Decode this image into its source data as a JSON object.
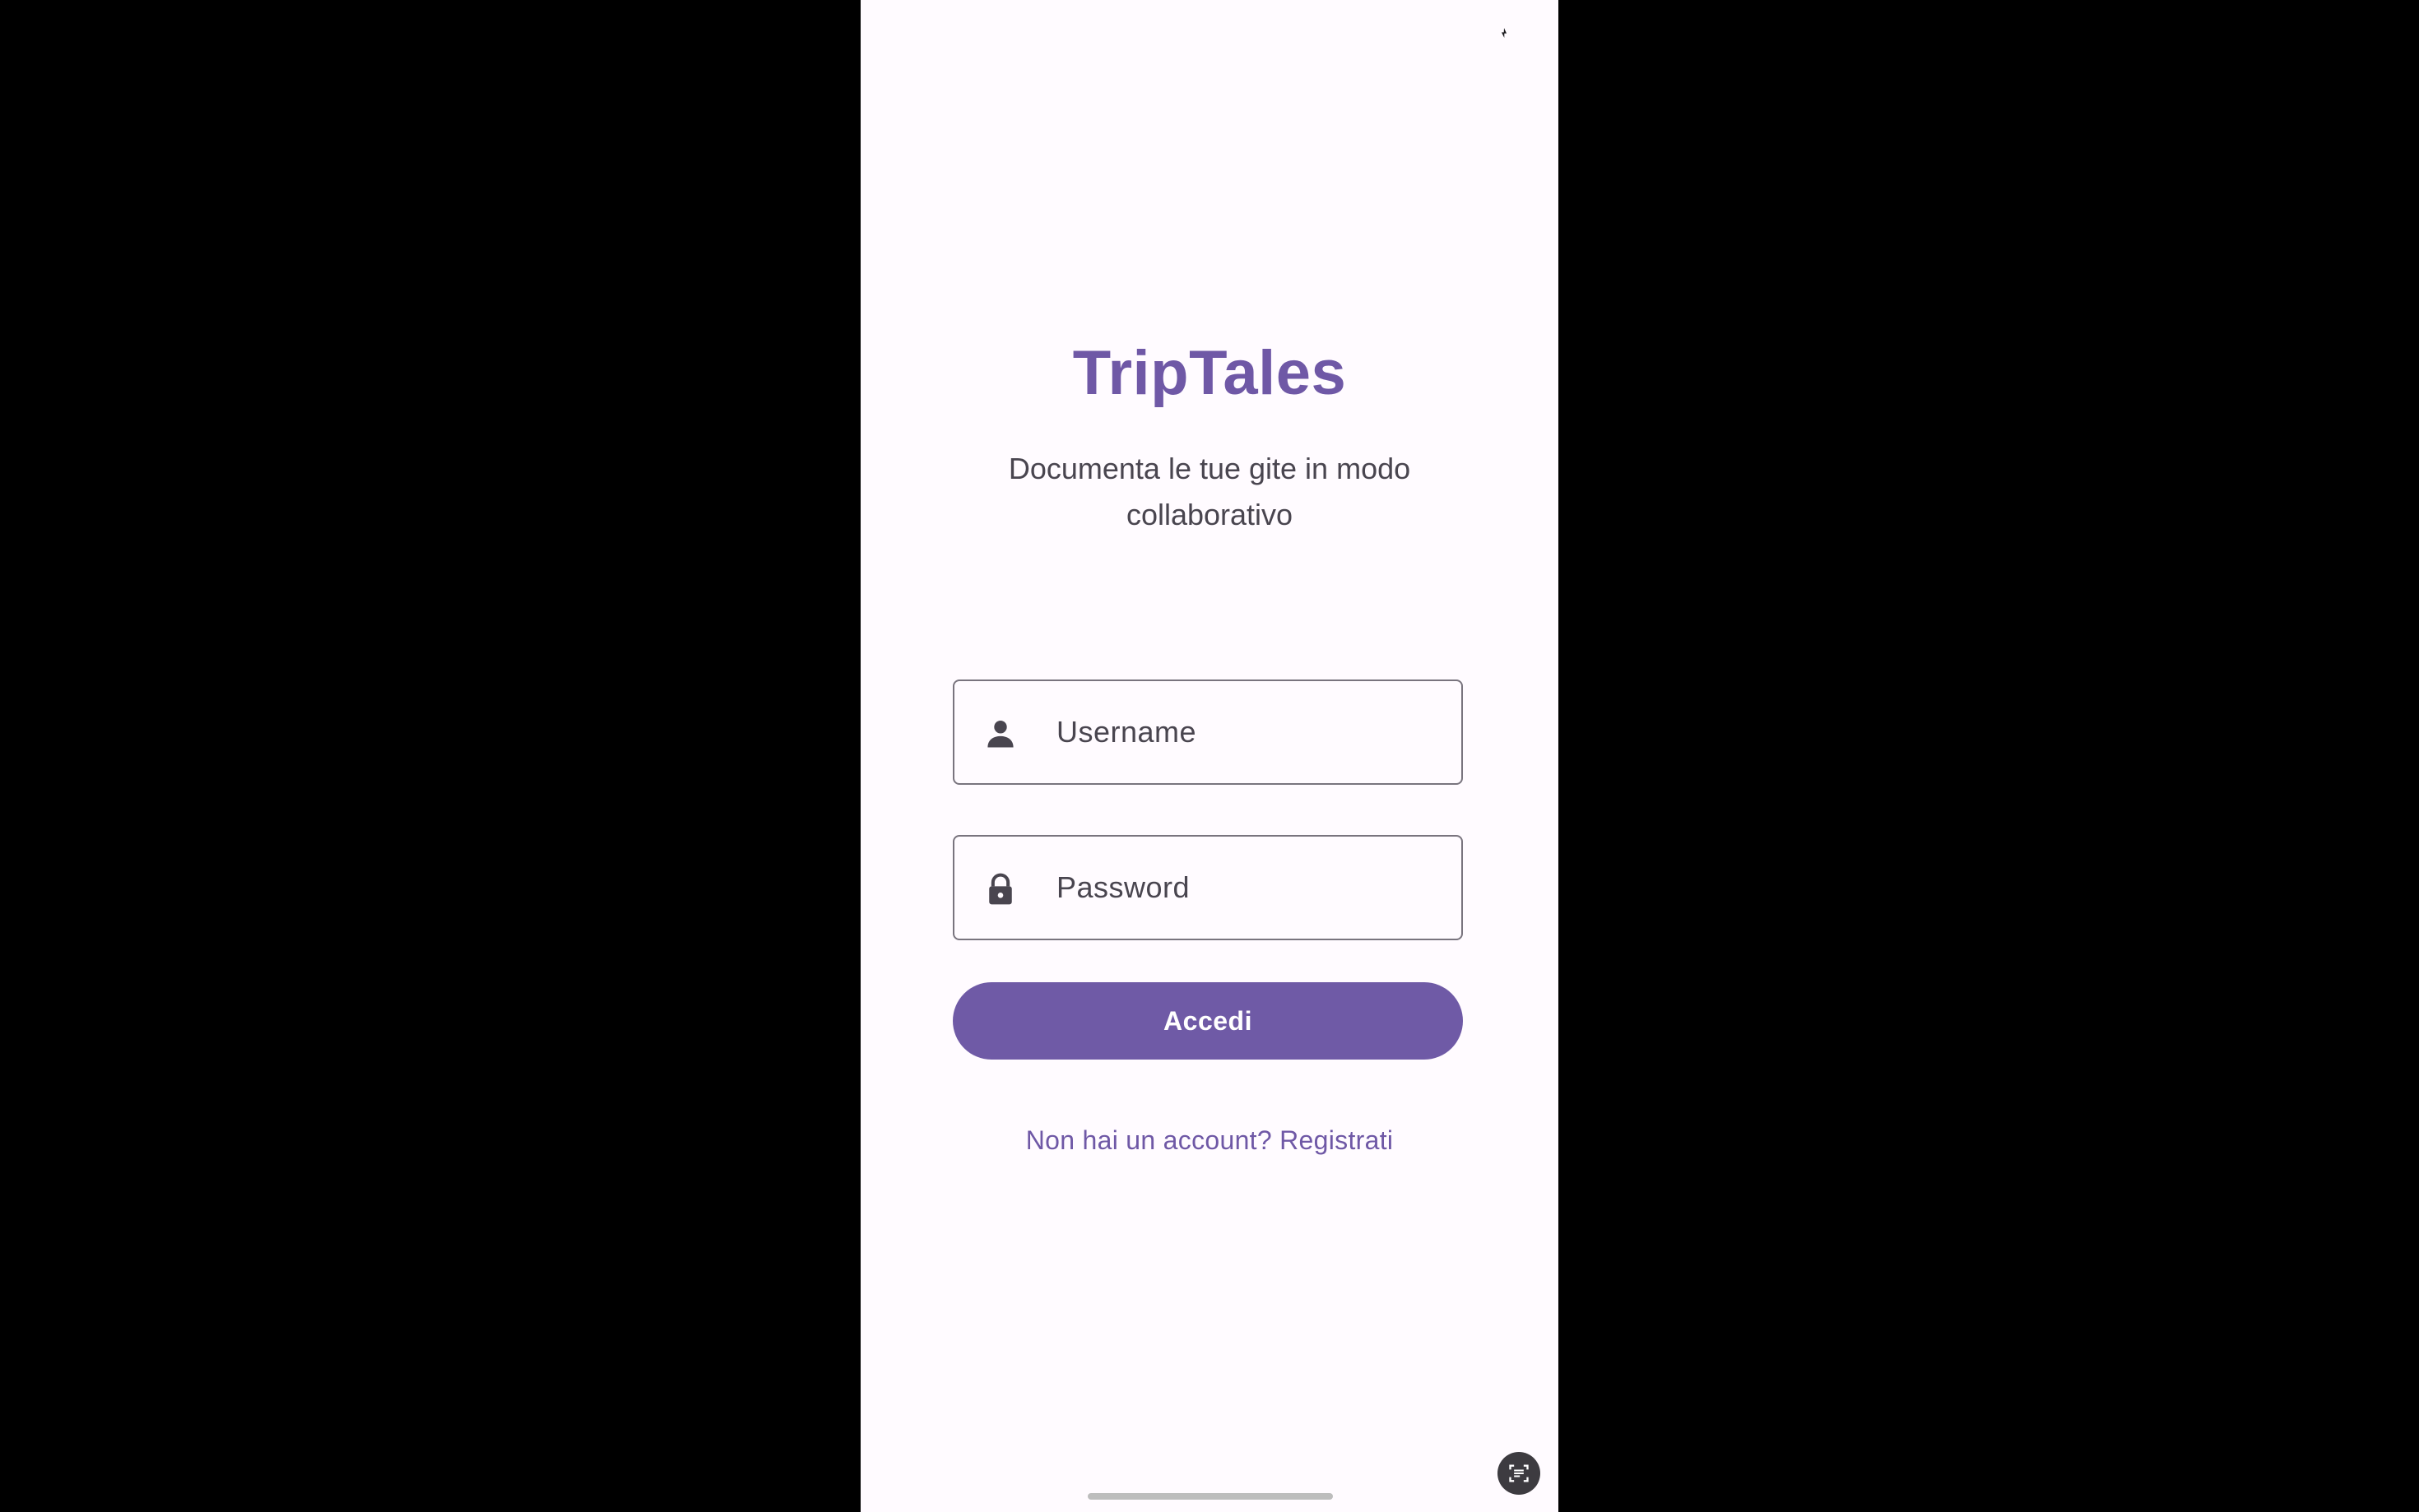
{
  "app": {
    "title": "TripTales",
    "subtitle": "Documenta le tue gite in modo collaborativo"
  },
  "login_form": {
    "username_placeholder": "Username",
    "password_placeholder": "Password",
    "submit_label": "Accedi",
    "register_link": "Non hai un account? Registrati"
  },
  "icons": {
    "username_field": "person-icon",
    "password_field": "lock-icon",
    "status_bar": "charging-bolt-icon",
    "floating": "screen-capture-icon"
  },
  "colors": {
    "accent": "#6f58a6",
    "background": "#fffbff",
    "outline": "#79747e",
    "text_secondary": "#49454f"
  }
}
